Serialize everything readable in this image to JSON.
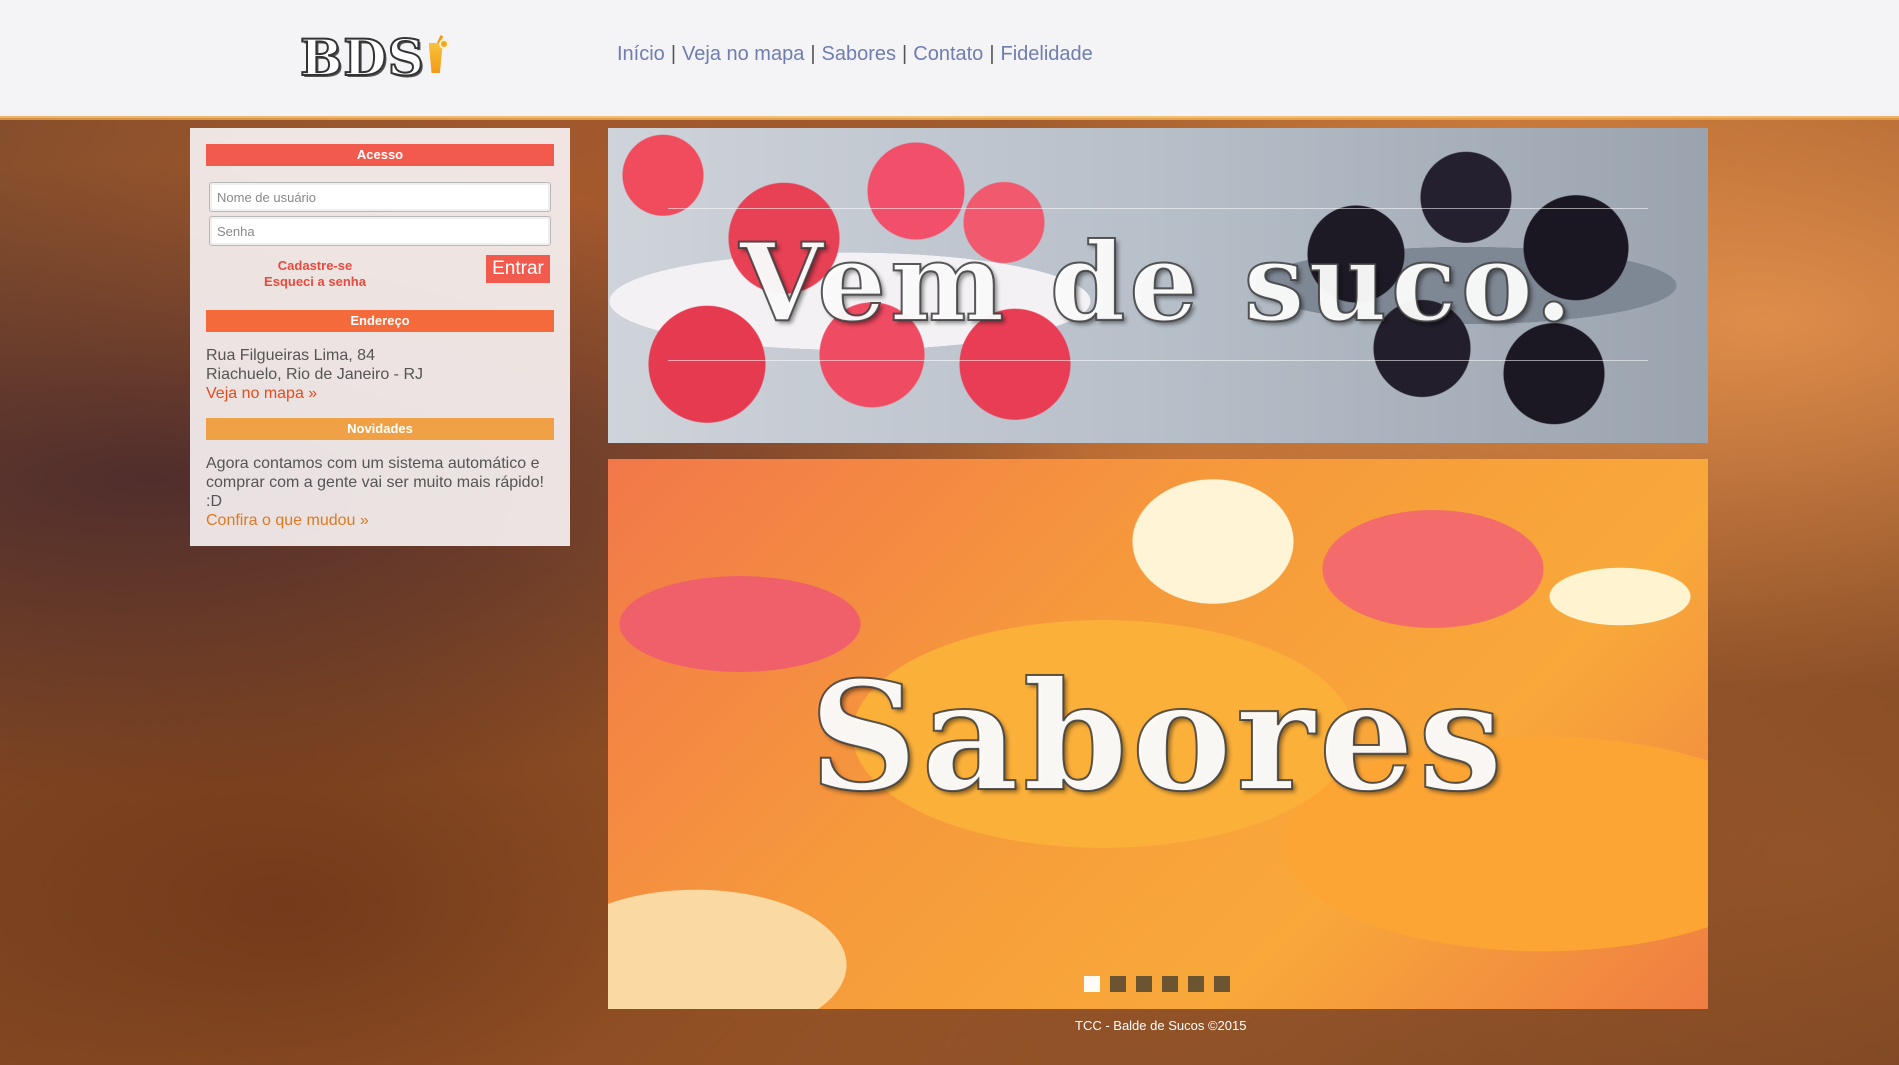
{
  "header": {
    "logo_text": "BDS",
    "nav": [
      {
        "label": "Início"
      },
      {
        "label": "Veja no mapa"
      },
      {
        "label": "Sabores"
      },
      {
        "label": "Contato"
      },
      {
        "label": "Fidelidade"
      }
    ],
    "separator": "|"
  },
  "panel": {
    "access": {
      "title": "Acesso",
      "username_placeholder": "Nome de usuário",
      "password_placeholder": "Senha",
      "register_link": "Cadastre-se",
      "forgot_link": "Esqueci a senha",
      "submit_label": "Entrar"
    },
    "address": {
      "title": "Endereço",
      "line1": "Rua Filgueiras Lima, 84",
      "line2": "Riachuelo, Rio de Janeiro - RJ",
      "map_link": "Veja no mapa »"
    },
    "news": {
      "title": "Novidades",
      "text": "Agora contamos com um sistema automático e comprar com a gente vai ser muito mais rápido! :D",
      "link": "Confira o que mudou »"
    }
  },
  "banners": {
    "top_title": "Vem de suco.",
    "main_title": "Sabores",
    "slide_count": 6,
    "active_slide": 1
  },
  "footer": {
    "text": "TCC - Balde de Sucos ©2015"
  },
  "colors": {
    "accent_red": "#f25a4e",
    "accent_orange_red": "#f46a3a",
    "accent_orange": "#f0a045",
    "nav_text": "#6f7db0"
  }
}
